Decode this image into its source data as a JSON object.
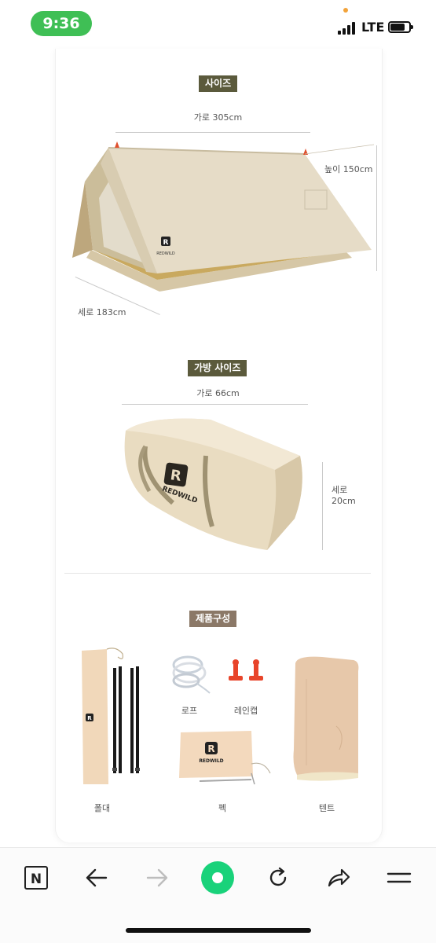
{
  "status_bar": {
    "time": "9:36",
    "network": "LTE"
  },
  "size_section": {
    "title": "사이즈",
    "width_label": "가로 305cm",
    "height_label": "높이 150cm",
    "depth_label": "세로 183cm",
    "logo_text": "REDWILD"
  },
  "bag_section": {
    "title": "가방 사이즈",
    "width_label": "가로 66cm",
    "height_label_line1": "세로",
    "height_label_line2": "20cm",
    "logo_text": "REDWILD"
  },
  "components_section": {
    "title": "제품구성",
    "items": {
      "pole": "폴대",
      "rope": "로프",
      "rain_cap": "레인캡",
      "peg": "펙",
      "tent": "텐트"
    },
    "peg_bag_logo": "REDWILD"
  },
  "colors": {
    "status_green": "#3fbf55",
    "chip_olive": "#5b5a3c",
    "chip_brown": "#8b7867",
    "tent_canvas": "#e8dcc6",
    "accent_green": "#19d27a"
  },
  "toolbar": {
    "icons": [
      "naver-n-icon",
      "back-arrow-icon",
      "forward-arrow-icon",
      "green-home-icon",
      "refresh-icon",
      "share-icon",
      "menu-icon"
    ]
  }
}
